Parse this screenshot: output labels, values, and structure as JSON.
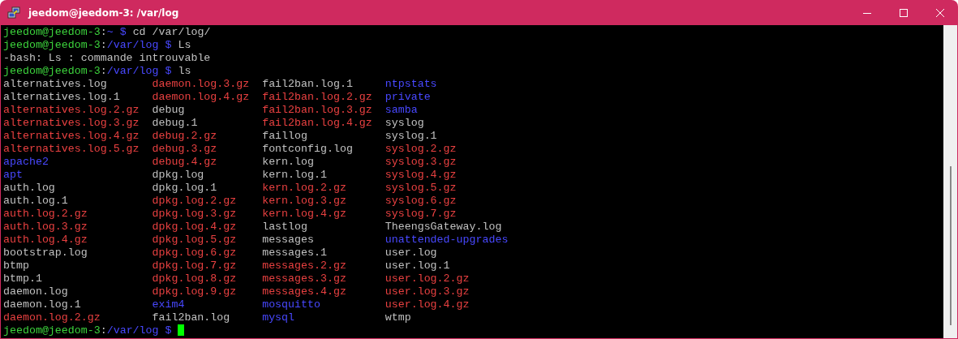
{
  "window": {
    "title": "jeedom@jeedom-3: /var/log"
  },
  "lines": [
    {
      "kind": "prompt",
      "user": "jeedom@jeedom-3",
      "separator": ":",
      "path": "~",
      "symbol": "$",
      "command": "cd /var/log/"
    },
    {
      "kind": "prompt",
      "user": "jeedom@jeedom-3",
      "separator": ":",
      "path": "/var/log",
      "symbol": "$",
      "command": "Ls"
    },
    {
      "kind": "output",
      "text": "-bash: Ls : commande introuvable"
    },
    {
      "kind": "prompt",
      "user": "jeedom@jeedom-3",
      "separator": ":",
      "path": "/var/log",
      "symbol": "$",
      "command": "ls"
    }
  ],
  "listing": [
    [
      {
        "name": "alternatives.log",
        "kind": "file"
      },
      {
        "name": "alternatives.log.1",
        "kind": "file"
      },
      {
        "name": "alternatives.log.2.gz",
        "kind": "archive"
      },
      {
        "name": "alternatives.log.3.gz",
        "kind": "archive"
      },
      {
        "name": "alternatives.log.4.gz",
        "kind": "archive"
      },
      {
        "name": "alternatives.log.5.gz",
        "kind": "archive"
      },
      {
        "name": "apache2",
        "kind": "directory"
      },
      {
        "name": "apt",
        "kind": "directory"
      },
      {
        "name": "auth.log",
        "kind": "file"
      },
      {
        "name": "auth.log.1",
        "kind": "file"
      },
      {
        "name": "auth.log.2.gz",
        "kind": "archive"
      },
      {
        "name": "auth.log.3.gz",
        "kind": "archive"
      },
      {
        "name": "auth.log.4.gz",
        "kind": "archive"
      },
      {
        "name": "bootstrap.log",
        "kind": "file"
      },
      {
        "name": "btmp",
        "kind": "file"
      },
      {
        "name": "btmp.1",
        "kind": "file"
      },
      {
        "name": "daemon.log",
        "kind": "file"
      },
      {
        "name": "daemon.log.1",
        "kind": "file"
      },
      {
        "name": "daemon.log.2.gz",
        "kind": "archive"
      }
    ],
    [
      {
        "name": "daemon.log.3.gz",
        "kind": "archive"
      },
      {
        "name": "daemon.log.4.gz",
        "kind": "archive"
      },
      {
        "name": "debug",
        "kind": "file"
      },
      {
        "name": "debug.1",
        "kind": "file"
      },
      {
        "name": "debug.2.gz",
        "kind": "archive"
      },
      {
        "name": "debug.3.gz",
        "kind": "archive"
      },
      {
        "name": "debug.4.gz",
        "kind": "archive"
      },
      {
        "name": "dpkg.log",
        "kind": "file"
      },
      {
        "name": "dpkg.log.1",
        "kind": "file"
      },
      {
        "name": "dpkg.log.2.gz",
        "kind": "archive"
      },
      {
        "name": "dpkg.log.3.gz",
        "kind": "archive"
      },
      {
        "name": "dpkg.log.4.gz",
        "kind": "archive"
      },
      {
        "name": "dpkg.log.5.gz",
        "kind": "archive"
      },
      {
        "name": "dpkg.log.6.gz",
        "kind": "archive"
      },
      {
        "name": "dpkg.log.7.gz",
        "kind": "archive"
      },
      {
        "name": "dpkg.log.8.gz",
        "kind": "archive"
      },
      {
        "name": "dpkg.log.9.gz",
        "kind": "archive"
      },
      {
        "name": "exim4",
        "kind": "directory"
      },
      {
        "name": "fail2ban.log",
        "kind": "file"
      }
    ],
    [
      {
        "name": "fail2ban.log.1",
        "kind": "file"
      },
      {
        "name": "fail2ban.log.2.gz",
        "kind": "archive"
      },
      {
        "name": "fail2ban.log.3.gz",
        "kind": "archive"
      },
      {
        "name": "fail2ban.log.4.gz",
        "kind": "archive"
      },
      {
        "name": "faillog",
        "kind": "file"
      },
      {
        "name": "fontconfig.log",
        "kind": "file"
      },
      {
        "name": "kern.log",
        "kind": "file"
      },
      {
        "name": "kern.log.1",
        "kind": "file"
      },
      {
        "name": "kern.log.2.gz",
        "kind": "archive"
      },
      {
        "name": "kern.log.3.gz",
        "kind": "archive"
      },
      {
        "name": "kern.log.4.gz",
        "kind": "archive"
      },
      {
        "name": "lastlog",
        "kind": "file"
      },
      {
        "name": "messages",
        "kind": "file"
      },
      {
        "name": "messages.1",
        "kind": "file"
      },
      {
        "name": "messages.2.gz",
        "kind": "archive"
      },
      {
        "name": "messages.3.gz",
        "kind": "archive"
      },
      {
        "name": "messages.4.gz",
        "kind": "archive"
      },
      {
        "name": "mosquitto",
        "kind": "directory"
      },
      {
        "name": "mysql",
        "kind": "directory"
      }
    ],
    [
      {
        "name": "ntpstats",
        "kind": "directory"
      },
      {
        "name": "private",
        "kind": "directory"
      },
      {
        "name": "samba",
        "kind": "directory"
      },
      {
        "name": "syslog",
        "kind": "file"
      },
      {
        "name": "syslog.1",
        "kind": "file"
      },
      {
        "name": "syslog.2.gz",
        "kind": "archive"
      },
      {
        "name": "syslog.3.gz",
        "kind": "archive"
      },
      {
        "name": "syslog.4.gz",
        "kind": "archive"
      },
      {
        "name": "syslog.5.gz",
        "kind": "archive"
      },
      {
        "name": "syslog.6.gz",
        "kind": "archive"
      },
      {
        "name": "syslog.7.gz",
        "kind": "archive"
      },
      {
        "name": "TheengsGateway.log",
        "kind": "file"
      },
      {
        "name": "unattended-upgrades",
        "kind": "directory"
      },
      {
        "name": "user.log",
        "kind": "file"
      },
      {
        "name": "user.log.1",
        "kind": "file"
      },
      {
        "name": "user.log.2.gz",
        "kind": "archive"
      },
      {
        "name": "user.log.3.gz",
        "kind": "archive"
      },
      {
        "name": "user.log.4.gz",
        "kind": "archive"
      },
      {
        "name": "wtmp",
        "kind": "file"
      }
    ]
  ],
  "final_prompt": {
    "user": "jeedom@jeedom-3",
    "separator": ":",
    "path": "/var/log",
    "symbol": "$",
    "cursor": true
  }
}
